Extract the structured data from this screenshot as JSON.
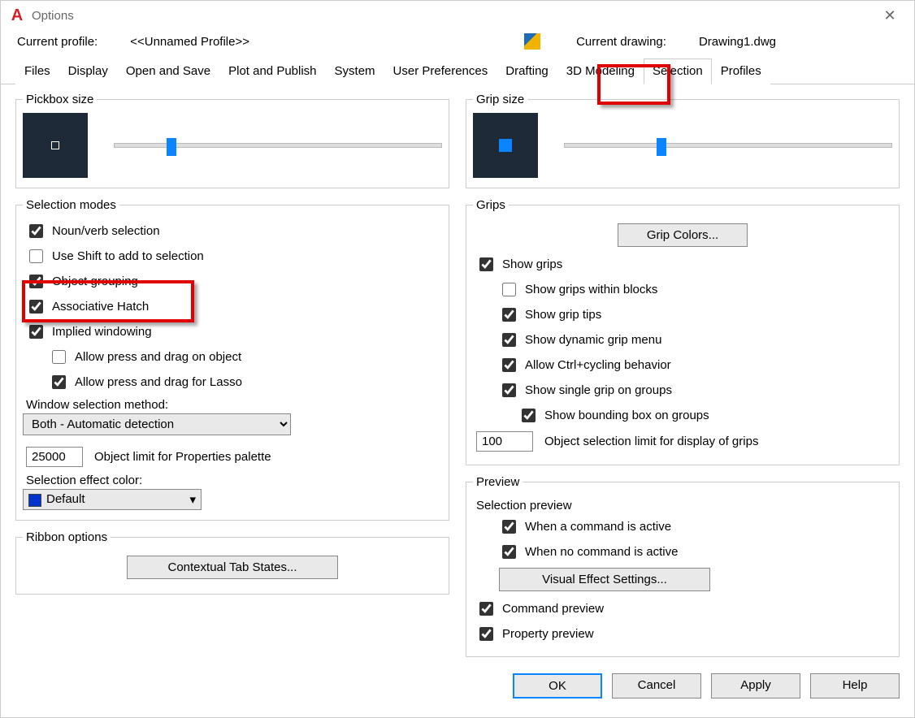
{
  "window": {
    "title": "Options"
  },
  "profile": {
    "label": "Current profile:",
    "value": "<<Unnamed Profile>>",
    "drawing_label": "Current drawing:",
    "drawing_value": "Drawing1.dwg"
  },
  "tabs": [
    "Files",
    "Display",
    "Open and Save",
    "Plot and Publish",
    "System",
    "User Preferences",
    "Drafting",
    "3D Modeling",
    "Selection",
    "Profiles"
  ],
  "active_tab": "Selection",
  "pickbox": {
    "legend": "Pickbox size",
    "slider_pct": 16
  },
  "gripsize": {
    "legend": "Grip size",
    "slider_pct": 28
  },
  "selection_modes": {
    "legend": "Selection modes",
    "noun_verb": {
      "label": "Noun/verb selection",
      "checked": true
    },
    "shift_add": {
      "label": "Use Shift to add to selection",
      "checked": false
    },
    "obj_group": {
      "label": "Object grouping",
      "checked": true
    },
    "assoc_hatch": {
      "label": "Associative Hatch",
      "checked": true
    },
    "implied_win": {
      "label": "Implied windowing",
      "checked": true
    },
    "press_drag_obj": {
      "label": "Allow press and drag on object",
      "checked": false
    },
    "press_drag_lasso": {
      "label": "Allow press and drag for Lasso",
      "checked": true
    },
    "win_sel_method_label": "Window selection method:",
    "win_sel_method": "Both - Automatic detection",
    "obj_limit_value": "25000",
    "obj_limit_label": "Object limit for Properties palette",
    "sel_effect_label": "Selection effect color:",
    "sel_effect_value": "Default"
  },
  "ribbon": {
    "legend": "Ribbon options",
    "btn": "Contextual Tab States..."
  },
  "grips": {
    "legend": "Grips",
    "colors_btn": "Grip Colors...",
    "show_grips": {
      "label": "Show grips",
      "checked": true
    },
    "within_blocks": {
      "label": "Show grips within blocks",
      "checked": false
    },
    "grip_tips": {
      "label": "Show grip tips",
      "checked": true
    },
    "dyn_menu": {
      "label": "Show dynamic grip menu",
      "checked": true
    },
    "ctrl_cycle": {
      "label": "Allow Ctrl+cycling behavior",
      "checked": true
    },
    "single_grip_groups": {
      "label": "Show single grip on groups",
      "checked": true
    },
    "bbox_groups": {
      "label": "Show bounding box on groups",
      "checked": true
    },
    "obj_sel_limit_value": "100",
    "obj_sel_limit_label": "Object selection limit for display of grips"
  },
  "preview": {
    "legend": "Preview",
    "sel_preview_label": "Selection preview",
    "cmd_active": {
      "label": "When a command is active",
      "checked": true
    },
    "no_cmd_active": {
      "label": "When no command is active",
      "checked": true
    },
    "visual_btn": "Visual Effect Settings...",
    "cmd_preview": {
      "label": "Command preview",
      "checked": true
    },
    "prop_preview": {
      "label": "Property preview",
      "checked": true
    }
  },
  "footer": {
    "ok": "OK",
    "cancel": "Cancel",
    "apply": "Apply",
    "help": "Help"
  }
}
